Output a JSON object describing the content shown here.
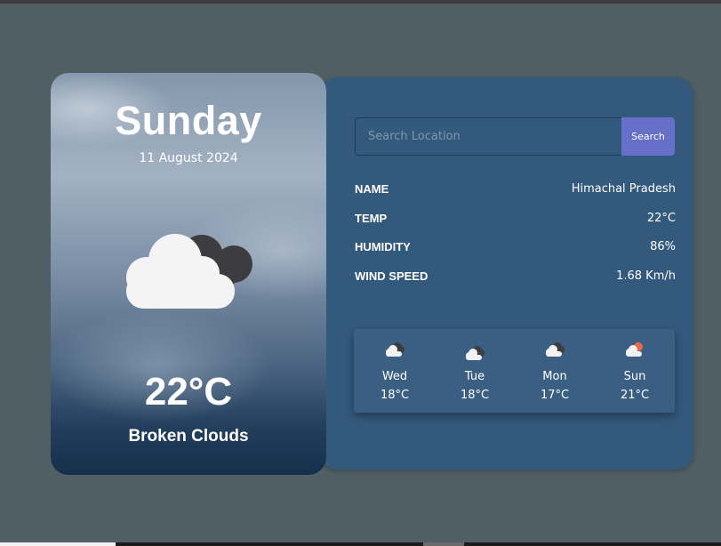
{
  "hero": {
    "day": "Sunday",
    "date": "11 August 2024",
    "icon": "broken-clouds-icon",
    "temperature": "22°C",
    "description": "Broken Clouds"
  },
  "search": {
    "placeholder": "Search Location",
    "value": "",
    "button_label": "Search"
  },
  "details": [
    {
      "label": "NAME",
      "value": "Himachal Pradesh"
    },
    {
      "label": "TEMP",
      "value": "22°C"
    },
    {
      "label": "HUMIDITY",
      "value": "86%"
    },
    {
      "label": "WIND SPEED",
      "value": "1.68 Km/h"
    }
  ],
  "forecast": [
    {
      "day": "Wed",
      "temp": "18°C",
      "icon": "broken-clouds-icon"
    },
    {
      "day": "Tue",
      "temp": "18°C",
      "icon": "broken-clouds-icon"
    },
    {
      "day": "Mon",
      "temp": "17°C",
      "icon": "broken-clouds-icon"
    },
    {
      "day": "Sun",
      "temp": "21°C",
      "icon": "partly-sunny-icon"
    }
  ],
  "colors": {
    "background": "#505f64",
    "card": "#33597c",
    "accent": "#6670c8"
  }
}
